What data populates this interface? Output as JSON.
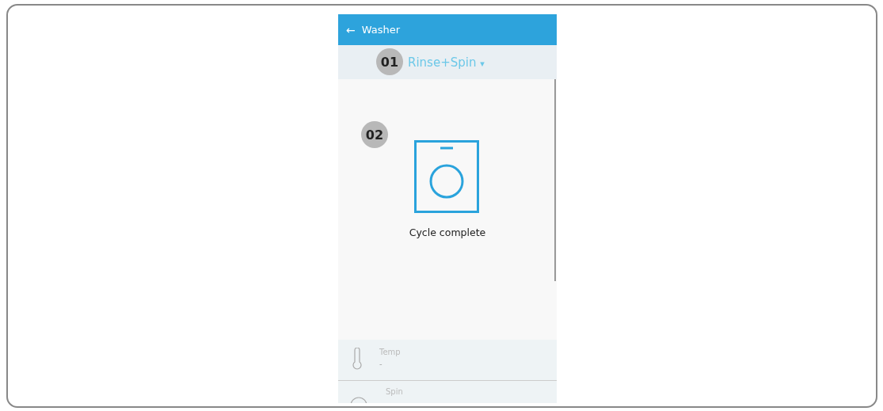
{
  "app_bar": {
    "back": "←",
    "title": "Washer"
  },
  "cycle_selector": {
    "value": "Rinse+Spin",
    "caret": "▾"
  },
  "status": {
    "message": "Cycle complete"
  },
  "callouts": [
    {
      "number": "01"
    },
    {
      "number": "02"
    }
  ],
  "settings": [
    {
      "kind": "temp",
      "label": "Temp",
      "value": "-"
    },
    {
      "kind": "spin",
      "label": "Spin"
    }
  ]
}
